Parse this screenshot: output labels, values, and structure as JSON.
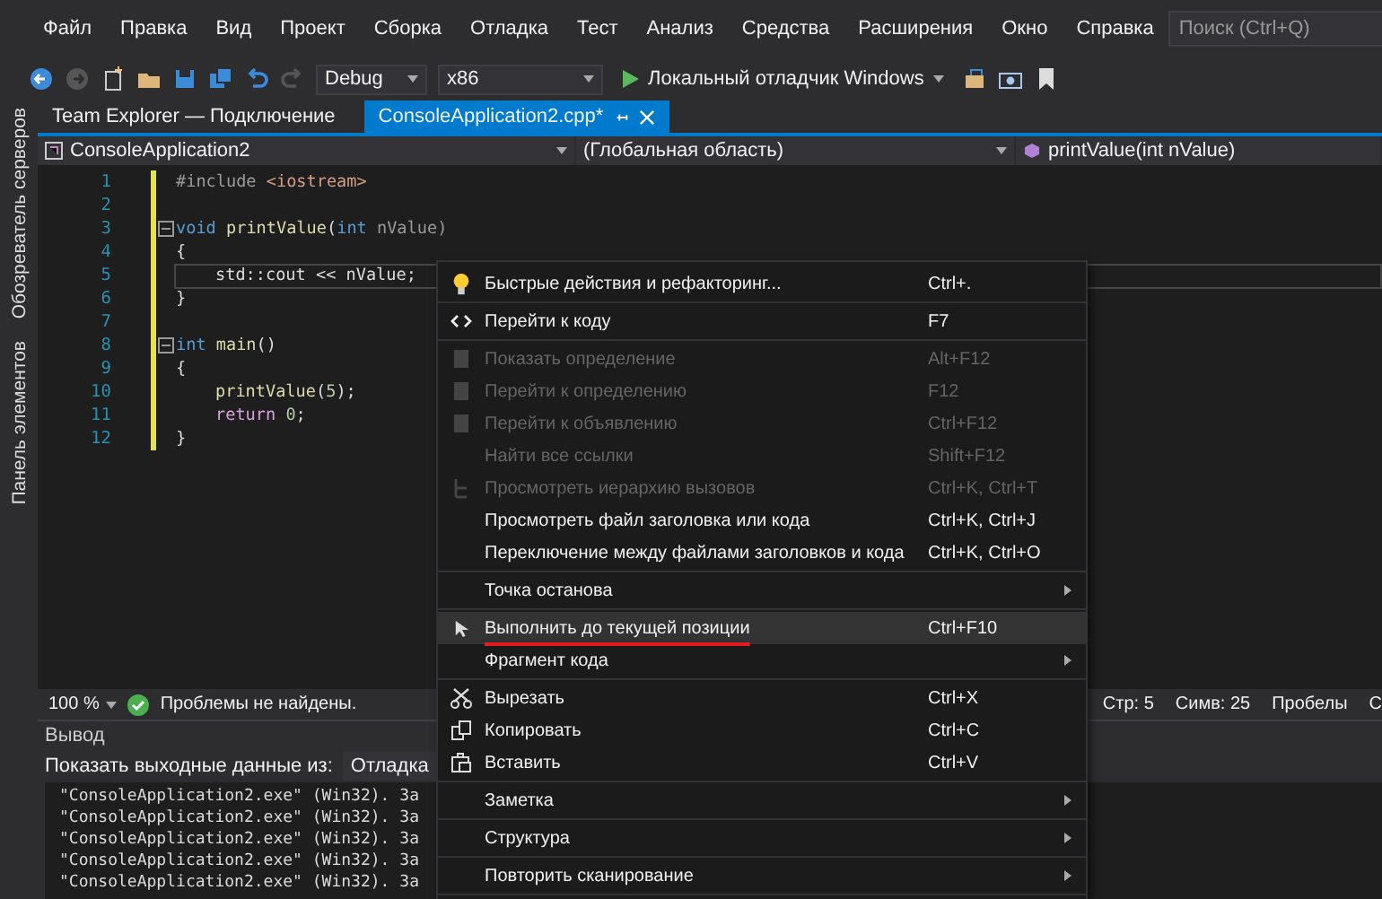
{
  "menubar": {
    "items": [
      "Файл",
      "Правка",
      "Вид",
      "Проект",
      "Сборка",
      "Отладка",
      "Тест",
      "Анализ",
      "Средства",
      "Расширения",
      "Окно",
      "Справка"
    ],
    "search": {
      "placeholder": "Поиск (Ctrl+Q)"
    }
  },
  "toolbar": {
    "configuration": "Debug",
    "platform": "x86",
    "run_label": "Локальный отладчик Windows"
  },
  "side_strip": [
    "Обозреватель серверов",
    "Панель элементов"
  ],
  "tabs": [
    {
      "label": "Team Explorer — Подключение",
      "selected": false
    },
    {
      "label": "ConsoleApplication2.cpp*",
      "selected": true
    }
  ],
  "navbar": {
    "project": "ConsoleApplication2",
    "scope": "(Глобальная область)",
    "member": "printValue(int nValue)"
  },
  "code": [
    {
      "number": "1",
      "foldable": false,
      "current": false,
      "indented": false,
      "tokens": [
        {
          "text": "#include ",
          "kind": "preprocessor"
        },
        {
          "text": "<iostream>",
          "kind": "string"
        }
      ]
    },
    {
      "number": "2",
      "foldable": false,
      "current": false
    },
    {
      "number": "3",
      "foldable": true,
      "current": false,
      "indented": false,
      "tokens": [
        {
          "text": "void ",
          "kind": "keyword"
        },
        {
          "text": "printValue",
          "kind": "function"
        },
        {
          "text": "(",
          "kind": "plain"
        },
        {
          "text": "int",
          "kind": "keyword"
        },
        {
          "text": " nValue)",
          "kind": "param"
        }
      ]
    },
    {
      "number": "4",
      "foldable": false,
      "current": false,
      "indented": false,
      "tokens": [
        {
          "text": "{",
          "kind": "plain"
        }
      ]
    },
    {
      "number": "5",
      "foldable": false,
      "current": true,
      "indented": true,
      "tokens": [
        {
          "text": "std::cout << nValue;",
          "kind": "plain"
        }
      ]
    },
    {
      "number": "6",
      "foldable": false,
      "current": false,
      "indented": false,
      "tokens": [
        {
          "text": "}",
          "kind": "plain"
        }
      ]
    },
    {
      "number": "7",
      "foldable": false,
      "current": false
    },
    {
      "number": "8",
      "foldable": true,
      "current": false,
      "indented": false,
      "tokens": [
        {
          "text": "int ",
          "kind": "keyword"
        },
        {
          "text": "main",
          "kind": "function"
        },
        {
          "text": "()",
          "kind": "plain"
        }
      ]
    },
    {
      "number": "9",
      "foldable": false,
      "current": false,
      "indented": false,
      "tokens": [
        {
          "text": "{",
          "kind": "plain"
        }
      ]
    },
    {
      "number": "10",
      "foldable": false,
      "current": false,
      "indented": true,
      "tokens": [
        {
          "text": "printValue",
          "kind": "function"
        },
        {
          "text": "(",
          "kind": "plain"
        },
        {
          "text": "5",
          "kind": "number"
        },
        {
          "text": ");",
          "kind": "plain"
        }
      ]
    },
    {
      "number": "11",
      "foldable": false,
      "current": false,
      "indented": true,
      "tokens": [
        {
          "text": "return ",
          "kind": "control"
        },
        {
          "text": "0",
          "kind": "number"
        },
        {
          "text": ";",
          "kind": "plain"
        }
      ]
    },
    {
      "number": "12",
      "foldable": false,
      "current": false,
      "indented": false,
      "tokens": [
        {
          "text": "}",
          "kind": "plain"
        }
      ]
    }
  ],
  "status": {
    "zoom": "100 %",
    "problems": "Проблемы не найдены.",
    "line": "Стр: 5",
    "column": "Симв: 25",
    "whitespace": "Пробелы",
    "column_4": "С"
  },
  "output": {
    "title": "Вывод",
    "source_label": "Показать выходные данные из:",
    "source": "Отладка",
    "lines": [
      "\"ConsoleApplication2.exe\" (Win32). За",
      "\"ConsoleApplication2.exe\" (Win32). За",
      "\"ConsoleApplication2.exe\" (Win32). За",
      "\"ConsoleApplication2.exe\" (Win32). За",
      "\"ConsoleApplication2.exe\" (Win32). За"
    ]
  },
  "context_menu": {
    "groups": [
      [
        {
          "label": "Быстрые действия и рефакторинг...",
          "shortcut": "Ctrl+.",
          "kind": "quick-actions",
          "disabled": false,
          "submenu": false,
          "selected": false,
          "underlined": false
        }
      ],
      [
        {
          "label": "Перейти к коду",
          "shortcut": "F7",
          "kind": "view-code",
          "disabled": false,
          "submenu": false,
          "selected": false,
          "underlined": false
        }
      ],
      [
        {
          "label": "Показать определение",
          "shortcut": "Alt+F12",
          "kind": "definition",
          "disabled": true,
          "submenu": false,
          "selected": false,
          "underlined": false
        },
        {
          "label": "Перейти к определению",
          "shortcut": "F12",
          "kind": "definition",
          "disabled": true,
          "submenu": false,
          "selected": false,
          "underlined": false
        },
        {
          "label": "Перейти к объявлению",
          "shortcut": "Ctrl+F12",
          "kind": "definition",
          "disabled": true,
          "submenu": false,
          "selected": false,
          "underlined": false
        },
        {
          "label": "Найти все ссылки",
          "shortcut": "Shift+F12",
          "kind": "plain",
          "disabled": true,
          "submenu": false,
          "selected": false,
          "underlined": false
        },
        {
          "label": "Просмотреть иерархию вызовов",
          "shortcut": "Ctrl+K, Ctrl+T",
          "kind": "hierarchy",
          "disabled": true,
          "submenu": false,
          "selected": false,
          "underlined": false
        },
        {
          "label": "Просмотреть файл заголовка или кода",
          "shortcut": "Ctrl+K, Ctrl+J",
          "kind": "plain",
          "disabled": false,
          "submenu": false,
          "selected": false,
          "underlined": false
        },
        {
          "label": "Переключение между файлами заголовков и кода",
          "shortcut": "Ctrl+K, Ctrl+O",
          "kind": "plain",
          "disabled": false,
          "submenu": false,
          "selected": false,
          "underlined": false
        }
      ],
      [
        {
          "label": "Точка останова",
          "kind": "plain",
          "disabled": false,
          "submenu": true,
          "selected": false,
          "underlined": false
        }
      ],
      [
        {
          "label": "Выполнить до текущей позиции",
          "shortcut": "Ctrl+F10",
          "kind": "run-to-cursor",
          "disabled": false,
          "submenu": false,
          "selected": true,
          "underlined": true
        },
        {
          "label": "Фрагмент кода",
          "kind": "plain",
          "disabled": false,
          "submenu": true,
          "selected": false,
          "underlined": false
        }
      ],
      [
        {
          "label": "Вырезать",
          "shortcut": "Ctrl+X",
          "kind": "cut",
          "disabled": false,
          "submenu": false,
          "selected": false,
          "underlined": false
        },
        {
          "label": "Копировать",
          "shortcut": "Ctrl+C",
          "kind": "copy",
          "disabled": false,
          "submenu": false,
          "selected": false,
          "underlined": false
        },
        {
          "label": "Вставить",
          "shortcut": "Ctrl+V",
          "kind": "paste",
          "disabled": false,
          "submenu": false,
          "selected": false,
          "underlined": false
        }
      ],
      [
        {
          "label": "Заметка",
          "kind": "plain",
          "disabled": false,
          "submenu": true,
          "selected": false,
          "underlined": false
        }
      ],
      [
        {
          "label": "Структура",
          "kind": "plain",
          "disabled": false,
          "submenu": true,
          "selected": false,
          "underlined": false
        }
      ],
      [
        {
          "label": "Повторить сканирование",
          "kind": "plain",
          "disabled": false,
          "submenu": true,
          "selected": false,
          "underlined": false
        }
      ]
    ]
  }
}
